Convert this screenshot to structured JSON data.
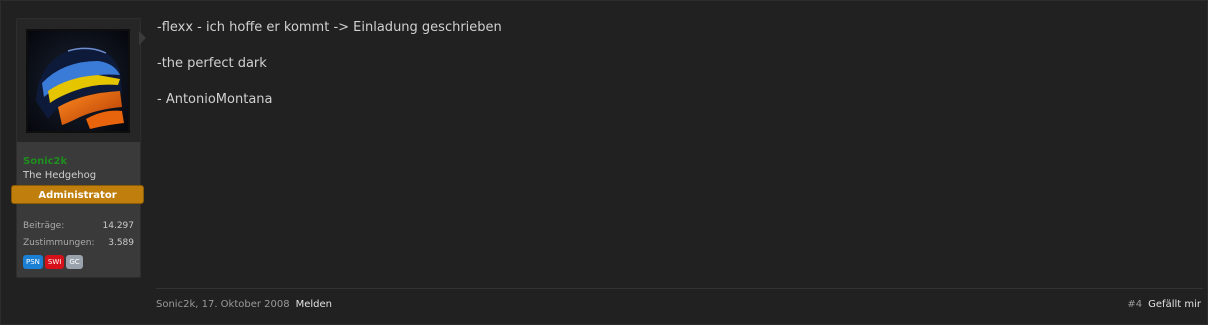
{
  "post": {
    "author": {
      "username": "Sonic2k",
      "user_title": "The Hedgehog",
      "banner": "Administrator",
      "stats": [
        {
          "label": "Beiträge:",
          "value": "14.297"
        },
        {
          "label": "Zustimmungen:",
          "value": "3.589"
        }
      ],
      "badges": [
        {
          "label": "PSN",
          "color": "#1b7fd4"
        },
        {
          "label": "SWI",
          "color": "#d6111a"
        },
        {
          "label": "GC",
          "color": "#9aa3ad"
        }
      ]
    },
    "lines": [
      "-flexx - ich hoffe er kommt -> Einladung geschrieben",
      "-the perfect dark",
      "- AntonioMontana"
    ],
    "footer": {
      "meta": "Sonic2k, 17. Oktober 2008",
      "report": "Melden",
      "number": "#4",
      "like": "Gefällt mir"
    }
  },
  "colors": {
    "username": "#1e8f1e",
    "banner": "#c07f0c"
  }
}
